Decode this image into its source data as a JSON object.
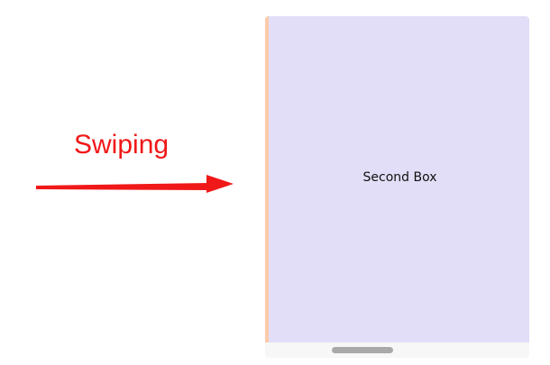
{
  "annotation": {
    "label": "Swiping",
    "color": "#f01818",
    "arrow_direction": "right",
    "arrow_icon": "arrow-right-icon"
  },
  "scroller": {
    "current_box": {
      "label": "Second Box",
      "background": "#e2def7"
    },
    "previous_box_edge_color": "#fccaa9",
    "scrollbar": {
      "orientation": "horizontal"
    }
  }
}
